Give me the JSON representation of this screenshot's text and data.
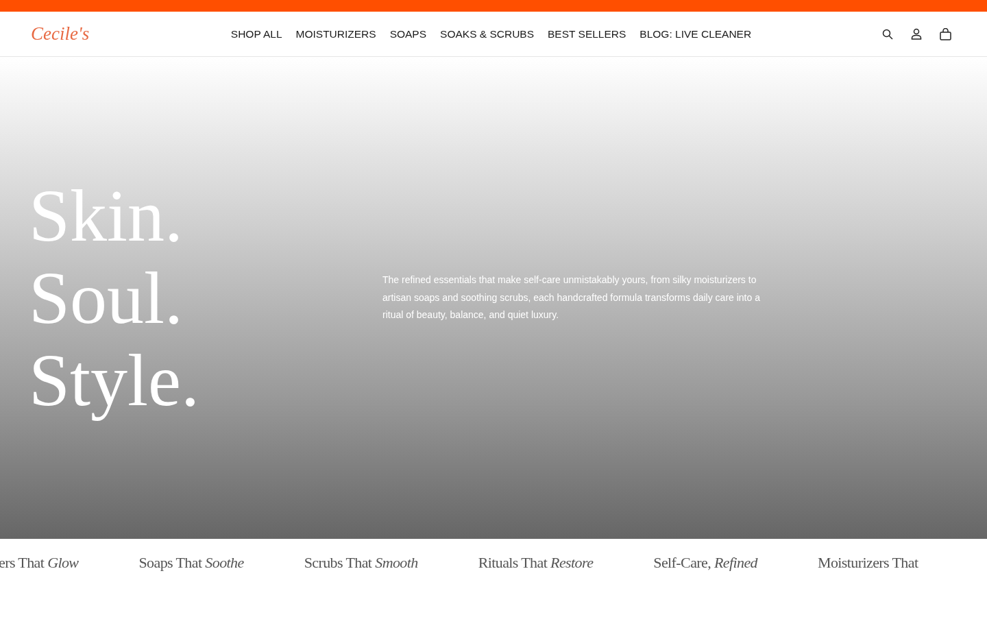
{
  "header": {
    "logo": "Cecile's",
    "nav": [
      {
        "label": "SHOP ALL"
      },
      {
        "label": "MOISTURIZERS"
      },
      {
        "label": "SOAPS"
      },
      {
        "label": "SOAKS & SCRUBS"
      },
      {
        "label": "BEST SELLERS"
      },
      {
        "label": "BLOG: LIVE CLEANER"
      }
    ]
  },
  "hero": {
    "headline": [
      "Skin.",
      "Soul.",
      "Style."
    ],
    "description": "The refined essentials that make self-care unmistakably yours, from silky moisturizers to artisan soaps and soothing scrubs, each handcrafted formula transforms daily care into a ritual of beauty, balance, and quiet luxury."
  },
  "ticker": [
    "ers That *Glow*",
    "Soaps That *Soothe*",
    "Scrubs That *Smooth*",
    "Rituals That *Restore*",
    "Self-Care, *Refined*",
    "Moisturizers That"
  ]
}
